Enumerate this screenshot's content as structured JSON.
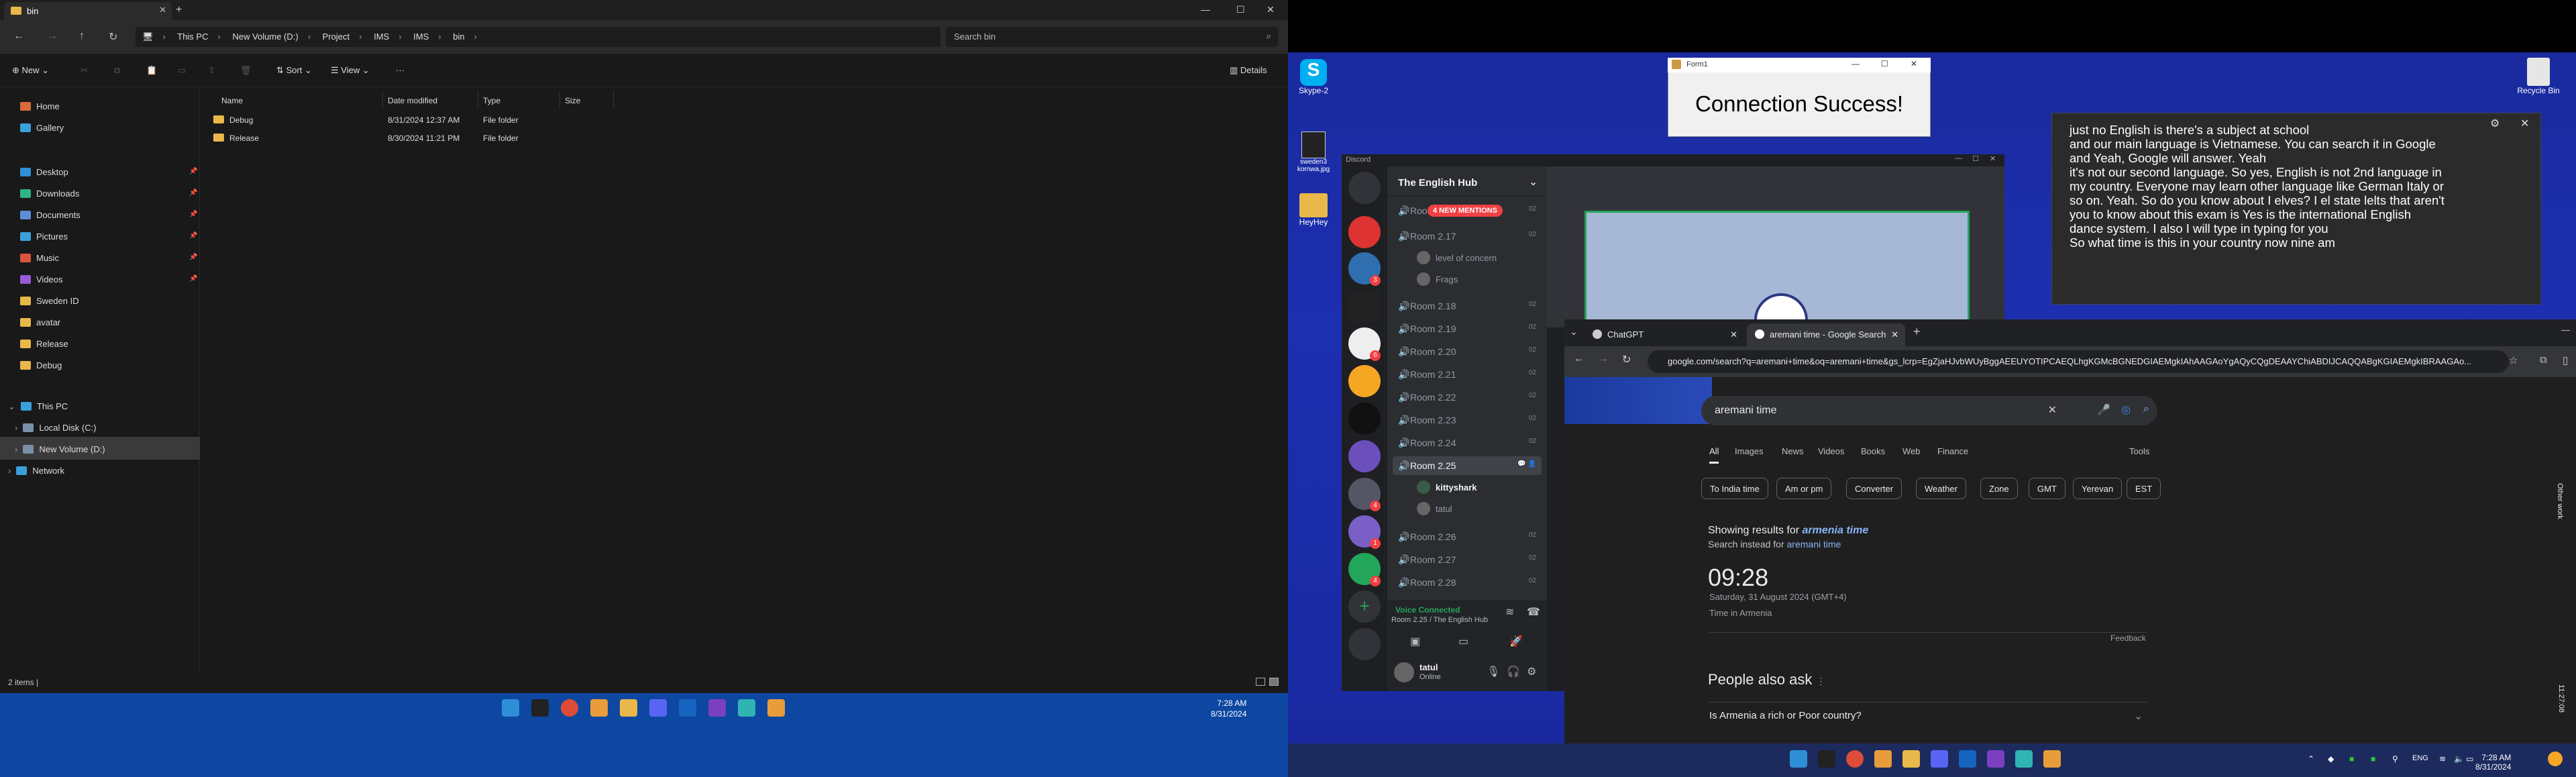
{
  "explorer": {
    "tab_title": "bin",
    "breadcrumbs": [
      "This PC",
      "New Volume (D:)",
      "Project",
      "IMS",
      "IMS",
      "bin"
    ],
    "search_placeholder": "Search bin",
    "toolbar": {
      "new": "New",
      "sort": "Sort",
      "view": "View",
      "more": "···",
      "details": "Details"
    },
    "sidebar": {
      "quick": [
        "Home",
        "Gallery"
      ],
      "pinned": [
        "Desktop",
        "Downloads",
        "Documents",
        "Pictures",
        "Music",
        "Videos",
        "Sweden ID",
        "avatar",
        "Release",
        "Debug"
      ],
      "tree": [
        "This PC",
        "Local Disk (C:)",
        "New Volume (D:)",
        "Network"
      ]
    },
    "columns": [
      "Name",
      "Date modified",
      "Type",
      "Size"
    ],
    "rows": [
      {
        "name": "Debug",
        "date": "8/31/2024 12:37 AM",
        "type": "File folder"
      },
      {
        "name": "Release",
        "date": "8/30/2024 11:21 PM",
        "type": "File folder"
      }
    ],
    "status": "2 items  |",
    "clock_time": "7:28 AM",
    "clock_date": "8/31/2024"
  },
  "desktop": {
    "icons": [
      "Skype-2",
      "sweden3 kornwa.jpg",
      "HeyHey",
      "Recycle Bin"
    ]
  },
  "form1": {
    "title": "Form1",
    "message": "Connection Success!"
  },
  "discord": {
    "app_title": "Discord",
    "guild": "The English Hub",
    "mentions_badge": "4 NEW MENTIONS",
    "channels": [
      {
        "name": "Room 2.16",
        "count": "02"
      },
      {
        "name": "Room 2.17",
        "count": "02"
      },
      {
        "name": "Room 2.18",
        "count": "02"
      },
      {
        "name": "Room 2.19",
        "count": "02"
      },
      {
        "name": "Room 2.20",
        "count": "02"
      },
      {
        "name": "Room 2.21",
        "count": "02"
      },
      {
        "name": "Room 2.22",
        "count": "02"
      },
      {
        "name": "Room 2.23",
        "count": "02"
      },
      {
        "name": "Room 2.24",
        "count": "02"
      },
      {
        "name": "Room 2.25",
        "count": ""
      },
      {
        "name": "Room 2.26",
        "count": "02"
      },
      {
        "name": "Room 2.27",
        "count": "02"
      },
      {
        "name": "Room 2.28",
        "count": "02"
      }
    ],
    "room217_users": [
      "level of concern",
      "Frags"
    ],
    "room225_users": [
      "kittyshark",
      "tatul"
    ],
    "voice_status": "Voice Connected",
    "voice_location": "Room 2.25 / The English Hub",
    "user_name": "tatul",
    "user_status": "Online",
    "server_badges": [
      "3",
      "6",
      "4",
      "1",
      "4",
      "5"
    ]
  },
  "subtitle": {
    "lines": [
      "just no English is there's a subject at school",
      "and our main language is Vietnamese. You can search it in Google",
      "and Yeah, Google will answer. Yeah",
      "it's not our second language. So yes, English is not 2nd language in",
      "my country. Everyone may learn other language like German Italy or",
      "so on. Yeah. So do you know about I elves? I el state lelts that aren't",
      "you to know about this exam is Yes is the international English",
      "dance system. I also I will type in typing for you",
      "So what time is this in your country now nine am"
    ]
  },
  "chrome": {
    "tabs": [
      "ChatGPT",
      "aremani time - Google Search"
    ],
    "url": "google.com/search?q=aremani+time&oq=aremani+time&gs_lcrp=EgZjaHJvbWUyBggAEEUYOTIPCAEQLhgKGMcBGNEDGIAEMgkIAhAAGAoYgAQyCQgDEAAYChiABDIJCAQQABgKGIAEMgkIBRAAGAo...",
    "query": "aremani time",
    "search_tabs": [
      "All",
      "Images",
      "News",
      "Videos",
      "Books",
      "Web",
      "Finance"
    ],
    "tools": "Tools",
    "chips": [
      "To India time",
      "Am or pm",
      "Converter",
      "Weather",
      "Zone",
      "GMT",
      "Yerevan",
      "EST"
    ],
    "showing_prefix": "Showing results for ",
    "showing_term": "armenia time",
    "instead_prefix": "Search instead for ",
    "instead_term": "aremani time",
    "time": "09:28",
    "date": "Saturday, 31 August 2024 (GMT+4)",
    "place": "Time in Armenia",
    "feedback": "Feedback",
    "paa_title": "People also ask",
    "paa_q1": "Is Armenia a rich or Poor country?",
    "side_label": "Other work"
  },
  "taskbar2": {
    "lang": "ENG",
    "clock_time": "7:28 AM",
    "clock_date": "8/31/2024",
    "side_time": "11:27:08"
  }
}
